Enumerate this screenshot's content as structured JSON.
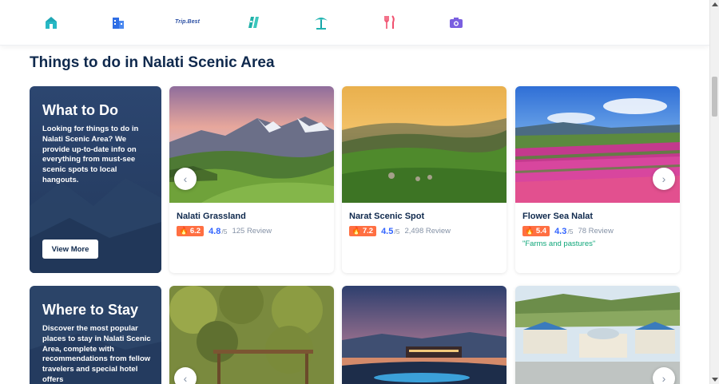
{
  "nav": {
    "icons": [
      "hotel-icon",
      "building-icon",
      "trip-best-logo",
      "attractions-icon",
      "beach-icon",
      "restaurant-icon",
      "camera-icon"
    ],
    "trip_best_label": "Trip.Best"
  },
  "section": {
    "title": "Things to do in Nalati Scenic Area"
  },
  "what_to_do": {
    "title": "What to Do",
    "description": "Looking for things to do in Nalati Scenic Area? We provide up-to-date info on everything from must-see scenic spots to local hangouts.",
    "button": "View More"
  },
  "where_to_stay": {
    "title": "Where to Stay",
    "description": "Discover the most popular places to stay in Nalati Scenic Area, complete with recommendations from fellow travelers and special hotel offers"
  },
  "attractions": [
    {
      "name": "Nalati Grassland",
      "heat": "6.2",
      "score": "4.8",
      "out_of": "/5",
      "reviews": "125 Review"
    },
    {
      "name": "Narat Scenic Spot",
      "heat": "7.2",
      "score": "4.5",
      "out_of": "/5",
      "reviews": "2,498 Review"
    },
    {
      "name": "Flower Sea Nalat",
      "heat": "5.4",
      "score": "4.3",
      "out_of": "/5",
      "reviews": "78 Review",
      "tag": "\"Farms and pastures\""
    }
  ],
  "colors": {
    "primary": "#0f294d",
    "score": "#3264ff",
    "badge": "#ff6f42",
    "tag": "#0ea679"
  }
}
